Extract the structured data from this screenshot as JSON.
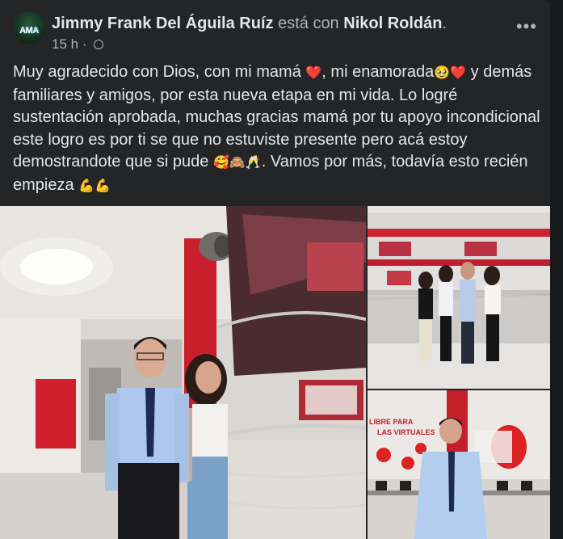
{
  "post": {
    "author": "Jimmy Frank Del Águila Ruíz",
    "with_text": "está con",
    "with_name": "Nikol Roldán",
    "period": ".",
    "time": "15 h",
    "dot": "·",
    "avatar_text": "AMA",
    "more_label": "•••",
    "text_parts": [
      "Muy agradecido con Dios, con mi  mamá ",
      "❤️",
      ", mi enamorada",
      "🥹❤️",
      " y demás familiares y amigos, por esta nueva etapa en mi vida. Lo logré sustentación aprobada, muchas gracias mamá por tu apoyo incondicional este logro es por ti se que no estuviste presente pero acá estoy demostrandote que si pude ",
      "🥰🙈🥂",
      ". Vamos por más, todavía esto recién empieza ",
      "💪💪"
    ]
  },
  "photos": {
    "right_bottom_sign": "LIBRE PARA\nLAS VIRTUALES"
  },
  "colors": {
    "background": "#18191a",
    "card": "#242526",
    "primary_text": "#e4e6eb",
    "secondary_text": "#b0b3b8",
    "accent_red": "#d2202e"
  }
}
